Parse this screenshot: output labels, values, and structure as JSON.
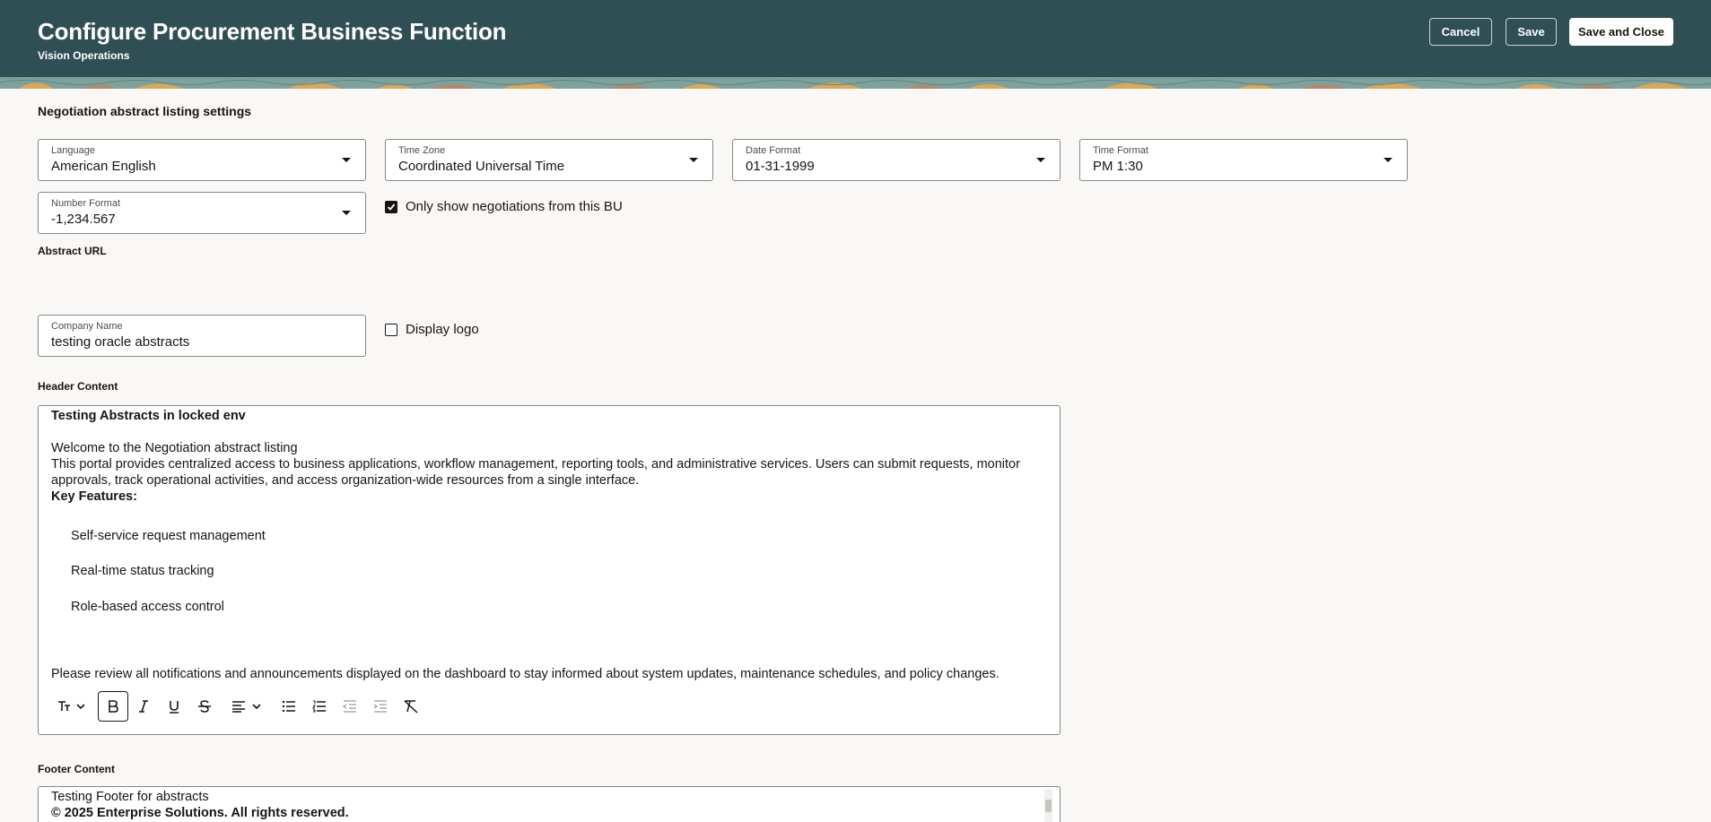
{
  "header": {
    "title": "Configure Procurement Business Function",
    "subtitle": "Vision Operations",
    "cancel_label": "Cancel",
    "save_label": "Save",
    "save_close_label": "Save and Close",
    "bg_color": "#304f55"
  },
  "section": {
    "title": "Negotiation abstract listing settings"
  },
  "fields": {
    "language": {
      "label": "Language",
      "value": "American English"
    },
    "timezone": {
      "label": "Time Zone",
      "value": "Coordinated Universal Time"
    },
    "date_format": {
      "label": "Date Format",
      "value": "01-31-1999"
    },
    "time_format": {
      "label": "Time Format",
      "value": "PM 1:30"
    },
    "number_format": {
      "label": "Number Format",
      "value": "-1,234.567"
    },
    "only_show": {
      "label": "Only show negotiations from this BU",
      "checked": true
    },
    "abstract_url_label": "Abstract URL",
    "company_name": {
      "label": "Company Name",
      "value": "testing oracle abstracts"
    },
    "display_logo": {
      "label": "Display logo",
      "checked": false
    }
  },
  "header_content": {
    "label": "Header Content",
    "title": "Testing Abstracts in locked env",
    "welcome": "Welcome to the Negotiation abstract listing",
    "para1": "This portal provides centralized access to business applications, workflow management, reporting tools, and administrative services. Users can submit requests, monitor",
    "para2": "approvals, track operational activities, and access organization-wide resources from a single interface.",
    "key_features": "Key Features:",
    "features": [
      "Self-service request management",
      "Real-time status tracking",
      "Role-based access control"
    ],
    "notice": "Please review all notifications and announcements displayed on the dashboard to stay informed about system updates, maintenance schedules, and policy changes."
  },
  "footer_content": {
    "label": "Footer Content",
    "line1": "Testing Footer for abstracts",
    "line2": "© 2025 Enterprise Solutions. All rights reserved."
  },
  "toolbar_icons": [
    "text-size-icon",
    "bold-icon",
    "italic-icon",
    "underline-icon",
    "strikethrough-icon",
    "align-left-icon",
    "bullet-list-icon",
    "numbered-list-icon",
    "outdent-icon",
    "indent-icon",
    "clear-format-icon"
  ]
}
